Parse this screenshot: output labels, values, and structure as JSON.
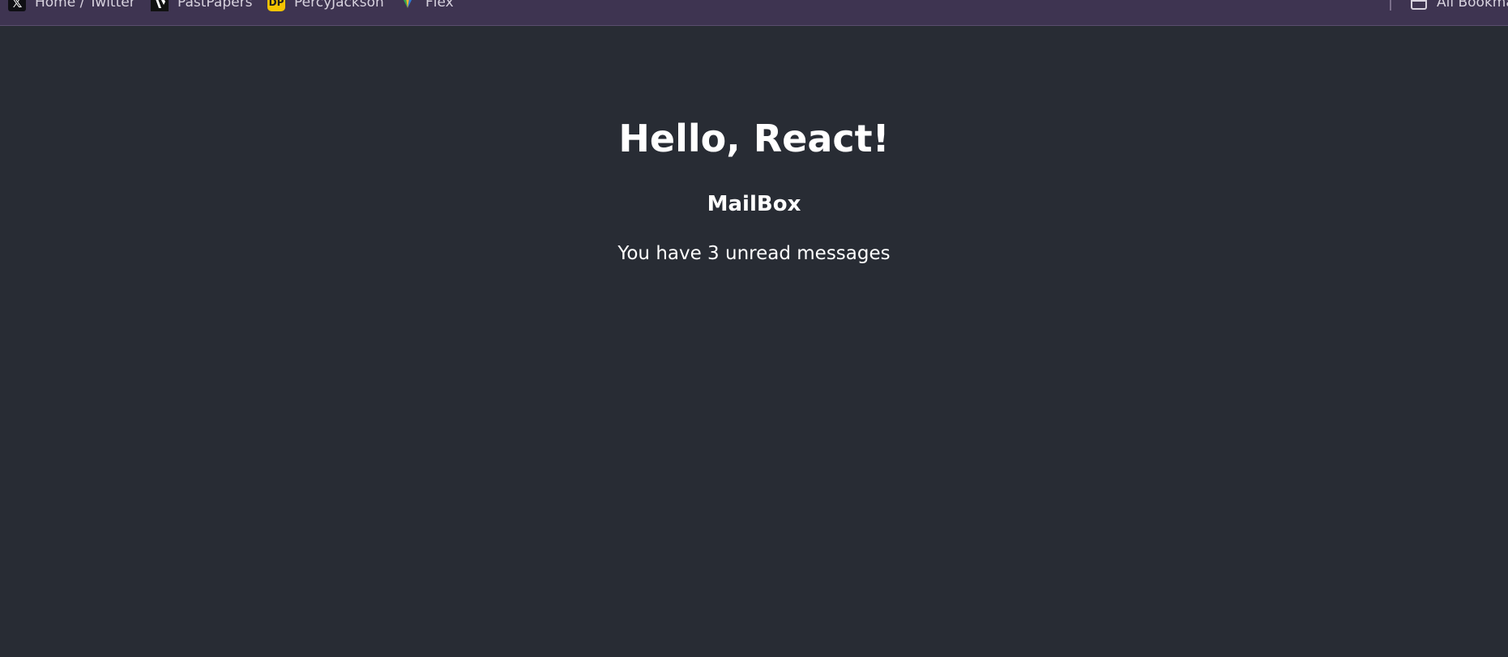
{
  "bookmarks": {
    "items": [
      {
        "label": "Home / Twitter",
        "icon": "x-logo-icon"
      },
      {
        "label": "PastPapers",
        "icon": "pastpapers-logo-icon"
      },
      {
        "label": "PercyJackson",
        "icon": "dp-logo-icon",
        "icon_text": "DP"
      },
      {
        "label": "Flex",
        "icon": "flex-logo-icon"
      }
    ],
    "all_bookmarks": {
      "label": "All Bookmarks",
      "icon": "folder-icon"
    }
  },
  "app": {
    "title": "Hello, React!",
    "subtitle": "MailBox",
    "message": "You have 3 unread messages"
  },
  "colors": {
    "background": "#282c34",
    "bookmarks_bar": "#3e3451",
    "text": "#ffffff"
  }
}
